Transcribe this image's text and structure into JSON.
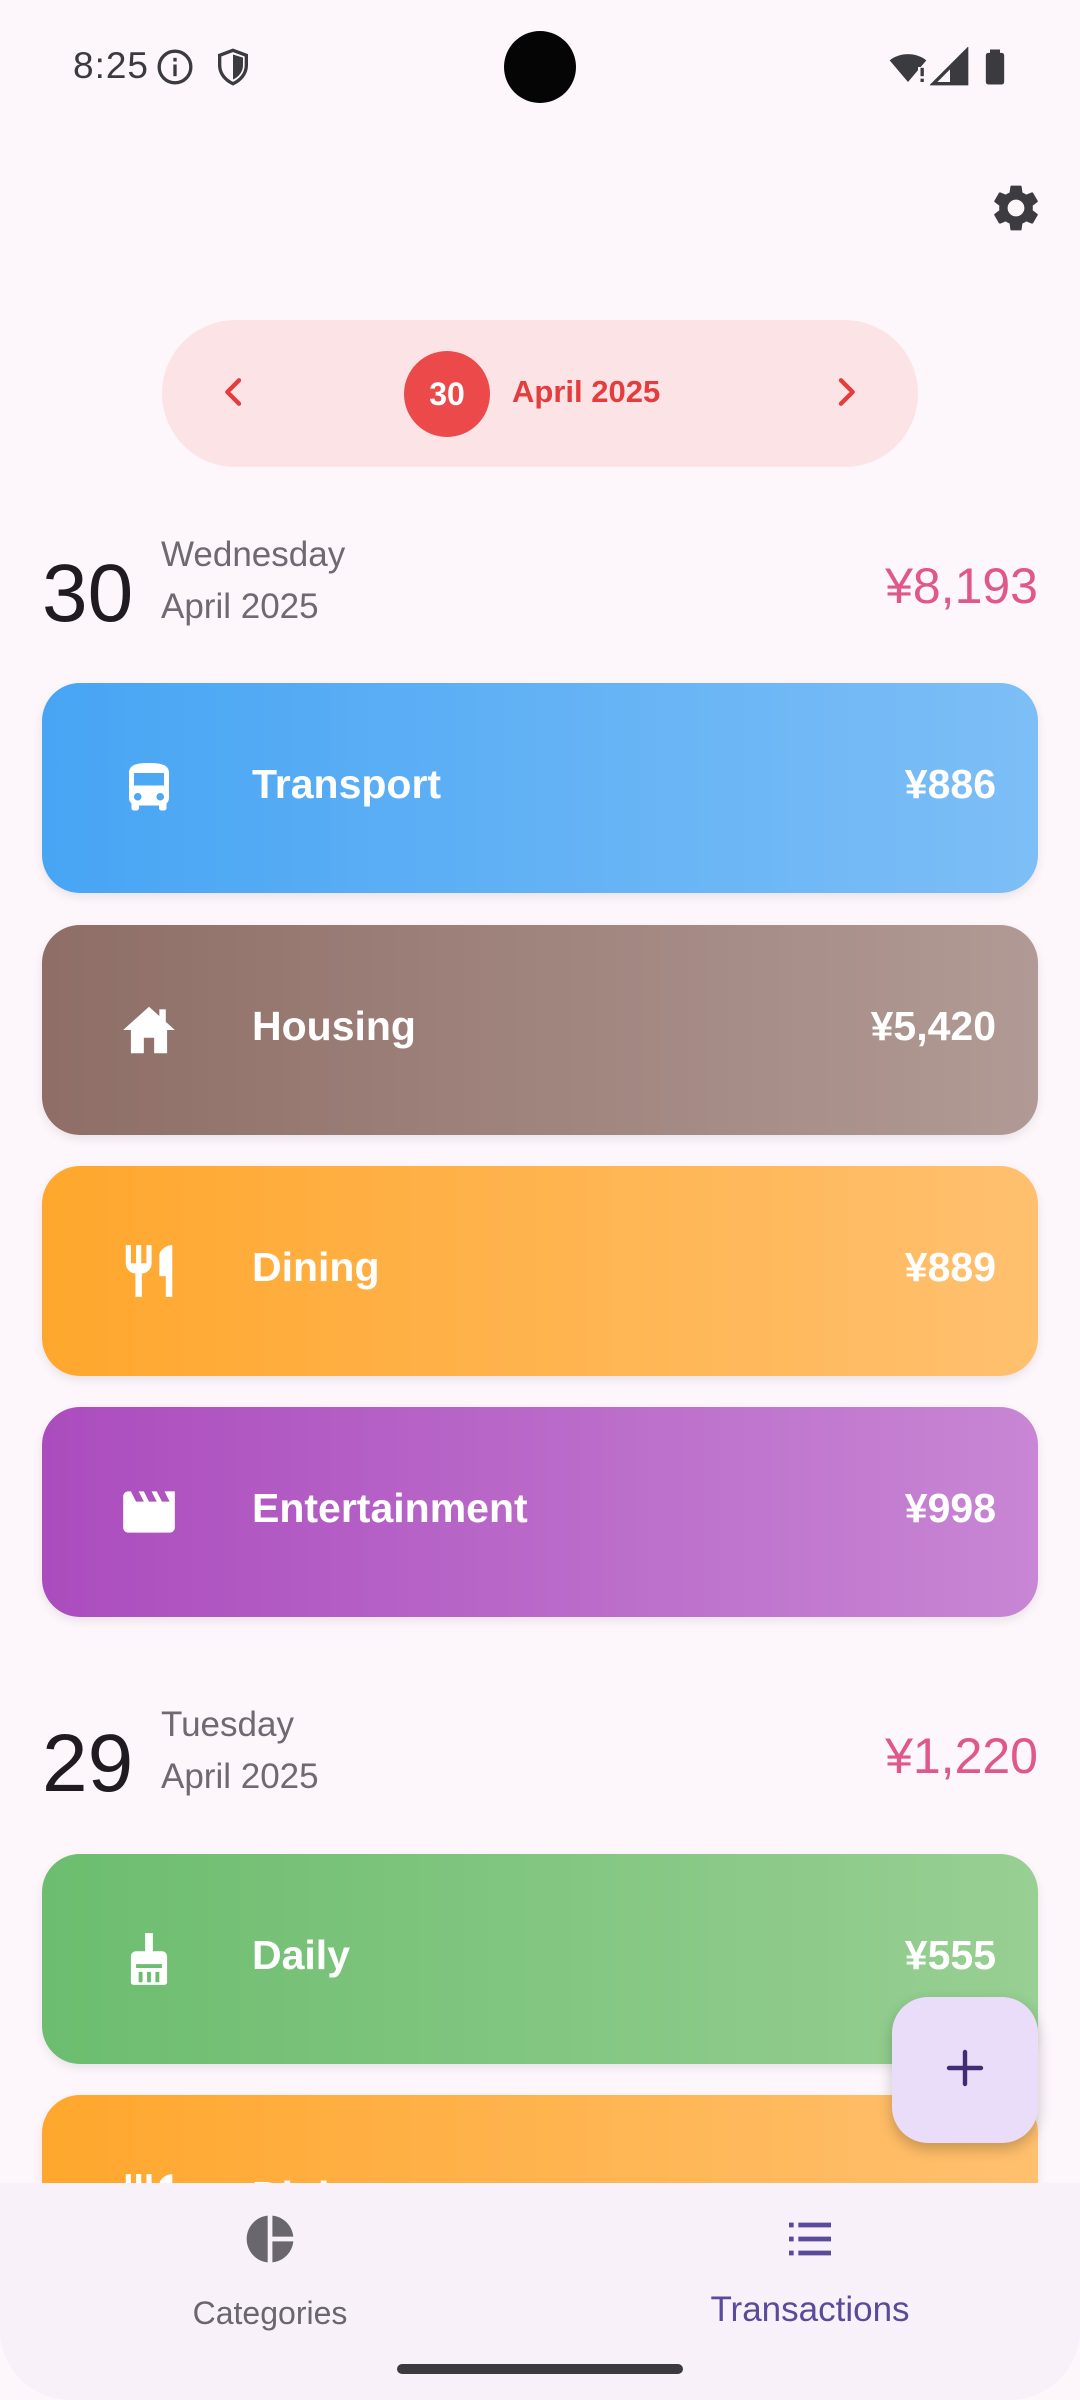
{
  "status_bar": {
    "time": "8:25",
    "icons": [
      "info-icon",
      "shield-icon",
      "wifi-icon",
      "signal-icon",
      "battery-icon"
    ]
  },
  "header": {
    "settings_icon": "gear-icon"
  },
  "date_selector": {
    "day": "30",
    "month_year": "April 2025",
    "prev_icon": "chevron-left-icon",
    "next_icon": "chevron-right-icon",
    "accent_color": "#ec4a4a"
  },
  "days": [
    {
      "day_number": "30",
      "weekday": "Wednesday",
      "month_year": "April 2025",
      "total": "¥8,193",
      "entries": [
        {
          "label": "Transport",
          "amount": "¥886",
          "icon": "bus-icon",
          "colors": [
            "#47a5f4",
            "#7dbef6"
          ]
        },
        {
          "label": "Housing",
          "amount": "¥5,420",
          "icon": "home-icon",
          "colors": [
            "#8e6e66",
            "#b19a95"
          ]
        },
        {
          "label": "Dining",
          "amount": "¥889",
          "icon": "restaurant-icon",
          "colors": [
            "#ffa72d",
            "#ffc06f"
          ]
        },
        {
          "label": "Entertainment",
          "amount": "¥998",
          "icon": "clapperboard-icon",
          "colors": [
            "#ab4cbe",
            "#c886d4"
          ]
        }
      ]
    },
    {
      "day_number": "29",
      "weekday": "Tuesday",
      "month_year": "April 2025",
      "total": "¥1,220",
      "entries": [
        {
          "label": "Daily",
          "amount": "¥555",
          "icon": "broom-icon",
          "colors": [
            "#6cbd6f",
            "#98cf93"
          ]
        },
        {
          "label": "Dining",
          "amount": "",
          "icon": "restaurant-icon",
          "colors": [
            "#ffa72d",
            "#ffc06f"
          ]
        }
      ]
    }
  ],
  "fab": {
    "icon": "plus-icon"
  },
  "bottom_nav": {
    "items": [
      {
        "label": "Categories",
        "icon": "pie-chart-icon",
        "active": false
      },
      {
        "label": "Transactions",
        "icon": "list-icon",
        "active": true
      }
    ]
  },
  "colors": {
    "background": "#fdf6fb",
    "total_color": "#e0578a",
    "active_nav": "#5a4a9a"
  }
}
